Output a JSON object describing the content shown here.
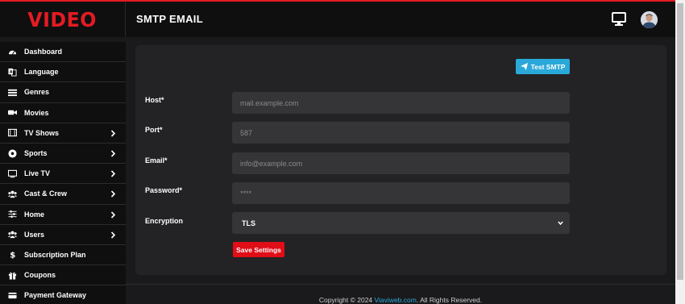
{
  "header": {
    "logo": "VIDEO",
    "title": "SMTP EMAIL",
    "icons": [
      "monitor-icon",
      "user-avatar"
    ]
  },
  "sidebar": {
    "items": [
      {
        "label": "Dashboard",
        "icon": "dashboard-icon",
        "chevron": false
      },
      {
        "label": "Language",
        "icon": "language-icon",
        "chevron": false
      },
      {
        "label": "Genres",
        "icon": "list-icon",
        "chevron": false
      },
      {
        "label": "Movies",
        "icon": "video-camera-icon",
        "chevron": false
      },
      {
        "label": "TV Shows",
        "icon": "film-icon",
        "chevron": true
      },
      {
        "label": "Sports",
        "icon": "soccer-ball-icon",
        "chevron": true
      },
      {
        "label": "Live TV",
        "icon": "tv-icon",
        "chevron": true
      },
      {
        "label": "Cast & Crew",
        "icon": "users-icon",
        "chevron": true
      },
      {
        "label": "Home",
        "icon": "sliders-icon",
        "chevron": true
      },
      {
        "label": "Users",
        "icon": "users-icon",
        "chevron": true
      },
      {
        "label": "Subscription Plan",
        "icon": "dollar-icon",
        "chevron": false
      },
      {
        "label": "Coupons",
        "icon": "gift-icon",
        "chevron": false
      },
      {
        "label": "Payment Gateway",
        "icon": "credit-card-icon",
        "chevron": false
      }
    ]
  },
  "form": {
    "test_button": "Test SMTP",
    "host": {
      "label": "Host*",
      "placeholder": "mail.example.com"
    },
    "port": {
      "label": "Port*",
      "placeholder": "587"
    },
    "email": {
      "label": "Email*",
      "placeholder": "info@example.com"
    },
    "password": {
      "label": "Password*",
      "placeholder": "****"
    },
    "encryption": {
      "label": "Encryption",
      "value": "TLS"
    },
    "save_button": "Save Settings"
  },
  "footer": {
    "prefix": "Copyright © 2024 ",
    "link": "Viaviweb.com",
    "suffix": ". All Rights Reserved."
  },
  "colors": {
    "accent_red": "#e31b23",
    "button_blue": "#2aa8d9",
    "sidebar_bg": "#0f0f10",
    "card_bg": "#232325",
    "input_bg": "#353537"
  }
}
